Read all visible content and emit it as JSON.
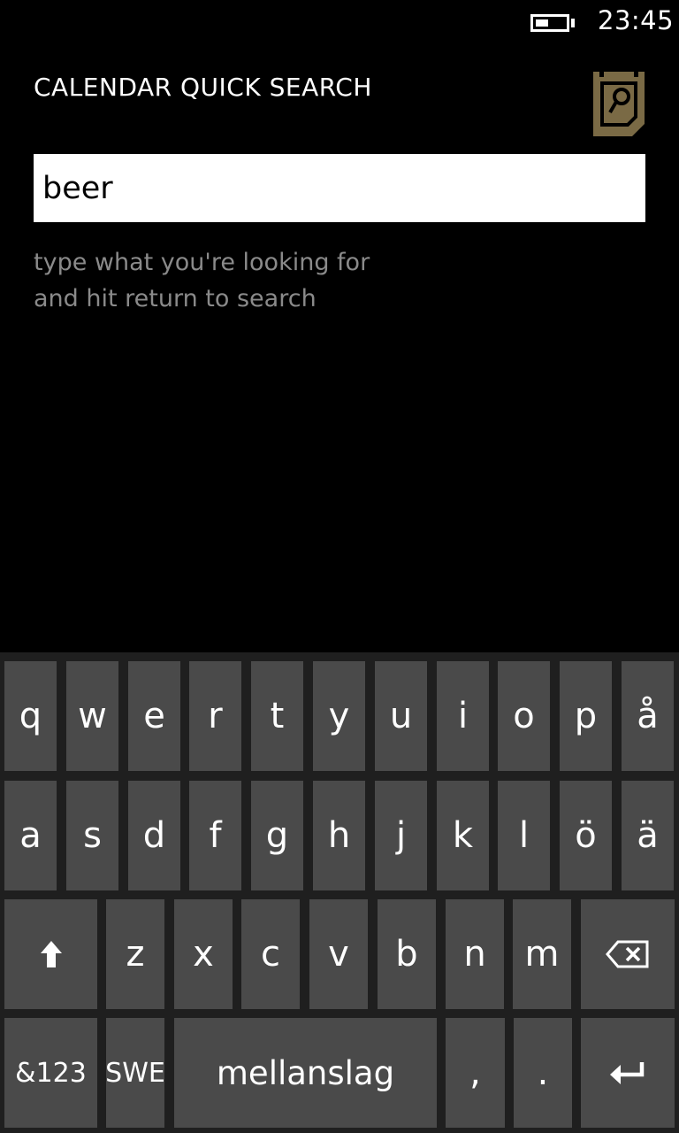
{
  "status_bar": {
    "time": "23:45",
    "battery_level": 0.45
  },
  "app": {
    "title": "CALENDAR QUICK SEARCH",
    "logo_icon": "calendar-search-icon",
    "accent_color": "#7a6a45"
  },
  "search": {
    "value": "beer",
    "hint_line1": "type what you're looking for",
    "hint_line2": "and hit return to search"
  },
  "keyboard": {
    "row1": [
      "q",
      "w",
      "e",
      "r",
      "t",
      "y",
      "u",
      "i",
      "o",
      "p",
      "å"
    ],
    "row2": [
      "a",
      "s",
      "d",
      "f",
      "g",
      "h",
      "j",
      "k",
      "l",
      "ö",
      "ä"
    ],
    "row3": [
      "z",
      "x",
      "c",
      "v",
      "b",
      "n",
      "m"
    ],
    "shift_icon": "shift-arrow-icon",
    "backspace_icon": "backspace-icon",
    "symbols_label": "&123",
    "language_label": "SWE",
    "space_label": "mellanslag",
    "comma_label": ",",
    "period_label": ".",
    "enter_icon": "enter-icon"
  }
}
